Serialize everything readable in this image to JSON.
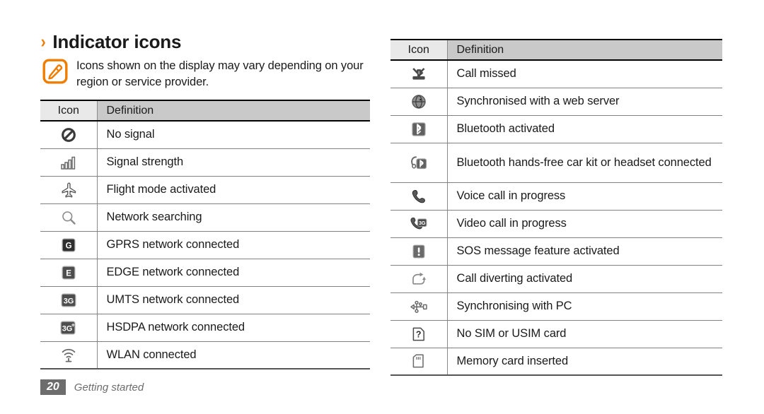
{
  "heading": {
    "chevron": "›",
    "title": "Indicator icons"
  },
  "note": {
    "icon": "note-pencil-icon",
    "text": "Icons shown on the display may vary depending on your region or service provider."
  },
  "tables": {
    "left": {
      "columns": [
        "Icon",
        "Definition"
      ],
      "rows": [
        {
          "icon": "no-signal-icon",
          "definition": "No signal"
        },
        {
          "icon": "signal-strength-icon",
          "definition": "Signal strength"
        },
        {
          "icon": "flight-mode-icon",
          "definition": "Flight mode activated"
        },
        {
          "icon": "network-searching-icon",
          "definition": "Network searching"
        },
        {
          "icon": "gprs-icon",
          "definition": "GPRS network connected"
        },
        {
          "icon": "edge-icon",
          "definition": "EDGE network connected"
        },
        {
          "icon": "umts-3g-icon",
          "definition": "UMTS network connected"
        },
        {
          "icon": "hsdpa-3g-plus-icon",
          "definition": "HSDPA network connected"
        },
        {
          "icon": "wlan-icon",
          "definition": "WLAN connected"
        }
      ]
    },
    "right": {
      "columns": [
        "Icon",
        "Definition"
      ],
      "rows": [
        {
          "icon": "call-missed-icon",
          "definition": "Call missed"
        },
        {
          "icon": "web-sync-icon",
          "definition": "Synchronised with a web server"
        },
        {
          "icon": "bluetooth-icon",
          "definition": "Bluetooth activated"
        },
        {
          "icon": "bluetooth-headset-icon",
          "definition": "Bluetooth hands-free car kit or headset connected",
          "tall": true
        },
        {
          "icon": "voice-call-icon",
          "definition": "Voice call in progress"
        },
        {
          "icon": "video-call-icon",
          "definition": "Video call in progress"
        },
        {
          "icon": "sos-message-icon",
          "definition": "SOS message feature activated"
        },
        {
          "icon": "call-diverting-icon",
          "definition": "Call diverting activated"
        },
        {
          "icon": "pc-sync-icon",
          "definition": "Synchronising with PC"
        },
        {
          "icon": "no-sim-card-icon",
          "definition": "No SIM or USIM card"
        },
        {
          "icon": "memory-card-icon",
          "definition": "Memory card inserted"
        }
      ]
    }
  },
  "footer": {
    "page_number": "20",
    "section": "Getting started"
  },
  "colors": {
    "accent": "#f07d00",
    "header_icon_bg": "#e9e9e9",
    "header_def_bg": "#c9c9c9",
    "rule": "#808080",
    "footer_box": "#6d6d6d",
    "text": "#1a1a1a"
  }
}
